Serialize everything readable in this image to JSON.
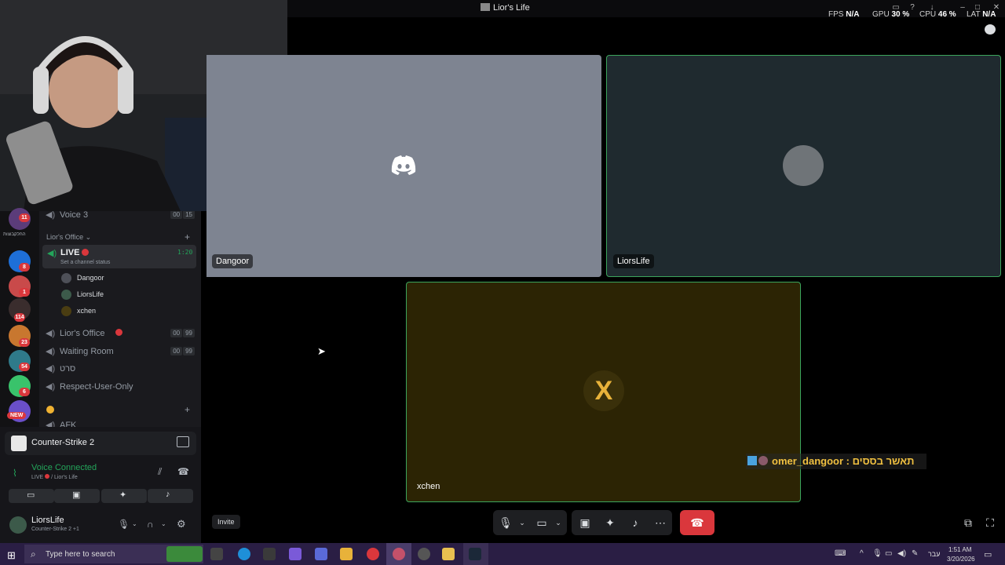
{
  "window": {
    "title": "Lior's Life",
    "stats": [
      {
        "label": "FPS",
        "value": "N/A"
      },
      {
        "label": "GPU",
        "value": "30 %"
      },
      {
        "label": "CPU",
        "value": "46 %"
      },
      {
        "label": "LAT",
        "value": "N/A"
      }
    ]
  },
  "guilds": {
    "badges": [
      "11",
      "8",
      "1",
      "114",
      "23",
      "54",
      "6"
    ],
    "new_label": "NEW",
    "server_label": "החלקבוצות"
  },
  "channels": {
    "voice3": {
      "name": "Voice 3",
      "counts": [
        "00",
        "15"
      ]
    },
    "category": "Lior's Office",
    "live": {
      "name": "LIVE",
      "time": "1:20",
      "status": "Set a channel status"
    },
    "members": [
      "Dangoor",
      "LiorsLife",
      "xchen"
    ],
    "liors_office": {
      "name": "Lior's Office",
      "counts": [
        "00",
        "99"
      ]
    },
    "waiting": {
      "name": "Waiting Room",
      "counts": [
        "00",
        "99"
      ]
    },
    "hebrew": "סרט",
    "respect": "Respect-User-Only",
    "afk": "AFK"
  },
  "activity": {
    "game": "Counter-Strike 2"
  },
  "voice": {
    "status": "Voice Connected",
    "channel": "LIVE",
    "server": "/ Lior's Life"
  },
  "user": {
    "name": "LiorsLife",
    "activity": "Counter-Strike 2 +1"
  },
  "tiles": {
    "dangoor": "Dangoor",
    "liorslife": "LiorsLife",
    "xchen": "xchen"
  },
  "overlay": {
    "chat": "omer_dangoor : תאשר בססים"
  },
  "controls": {
    "invite": "Invite"
  },
  "taskbar": {
    "search_placeholder": "Type here to search",
    "time": "1:51 AM",
    "date": "3/20/2026",
    "lang": "עבר"
  },
  "colors": {
    "live_red": "#da373c",
    "voice_green": "#23a55a",
    "end_call": "#da373c"
  }
}
